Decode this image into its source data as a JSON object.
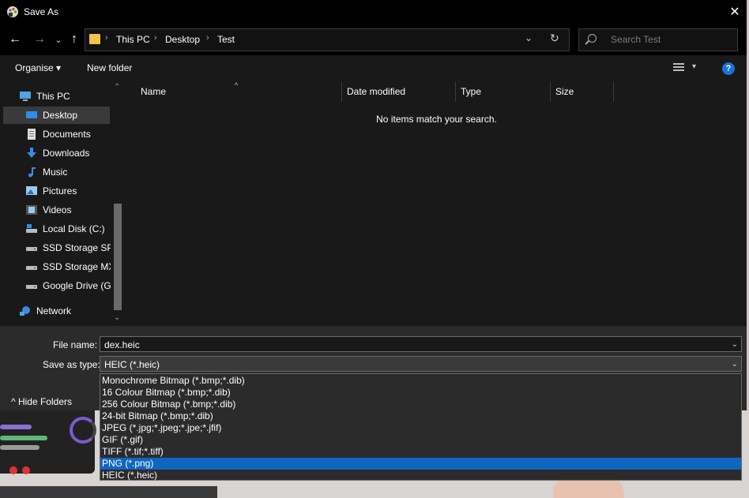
{
  "window": {
    "title": "Save As",
    "close_glyph": "✕"
  },
  "nav": {
    "back": "←",
    "forward": "→",
    "recent": "⌄",
    "up": "↑",
    "breadcrumbs": [
      "This PC",
      "Desktop",
      "Test"
    ],
    "crumb_sep": "›",
    "dropdown": "⌄",
    "refresh": "↻",
    "search_placeholder": "Search Test"
  },
  "toolbar": {
    "organise": "Organise ▾",
    "new_folder": "New folder",
    "view_dd": "▾",
    "help": "?"
  },
  "sidebar": {
    "items": [
      {
        "label": "This PC",
        "icon": "pc-icon"
      },
      {
        "label": "Desktop",
        "icon": "desktop-icon",
        "selected": true
      },
      {
        "label": "Documents",
        "icon": "documents-icon"
      },
      {
        "label": "Downloads",
        "icon": "downloads-icon"
      },
      {
        "label": "Music",
        "icon": "music-icon"
      },
      {
        "label": "Pictures",
        "icon": "pictures-icon"
      },
      {
        "label": "Videos",
        "icon": "videos-icon"
      },
      {
        "label": "Local Disk (C:)",
        "icon": "local-disk-icon"
      },
      {
        "label": "SSD Storage SP (",
        "icon": "drive-icon"
      },
      {
        "label": "SSD Storage MX",
        "icon": "drive-icon"
      },
      {
        "label": "Google Drive (G:",
        "icon": "drive-icon"
      },
      {
        "label": "Network",
        "icon": "network-icon"
      }
    ],
    "scroll_up": "⌃",
    "scroll_down": "⌄"
  },
  "filelist": {
    "columns": [
      "Name",
      "Date modified",
      "Type",
      "Size"
    ],
    "sort_glyph": "^",
    "empty_message": "No items match your search."
  },
  "form": {
    "file_name_label": "File name:",
    "file_name_value": "dex.heic",
    "type_label": "Save as type:",
    "type_value": "HEIC (*.heic)",
    "dd_glyph": "⌄",
    "hide_folders": "^   Hide Folders"
  },
  "type_options": [
    {
      "label": "Monochrome Bitmap (*.bmp;*.dib)"
    },
    {
      "label": "16 Colour Bitmap (*.bmp;*.dib)"
    },
    {
      "label": "256 Colour Bitmap (*.bmp;*.dib)"
    },
    {
      "label": "24-bit Bitmap (*.bmp;*.dib)"
    },
    {
      "label": "JPEG (*.jpg;*.jpeg;*.jpe;*.jfif)"
    },
    {
      "label": "GIF (*.gif)"
    },
    {
      "label": "TIFF (*.tif;*.tiff)"
    },
    {
      "label": "PNG (*.png)",
      "selected": true
    },
    {
      "label": "HEIC (*.heic)"
    }
  ],
  "colors": {
    "accent": "#0f66c0",
    "folder": "#f3c345",
    "help": "#1a72d9"
  }
}
